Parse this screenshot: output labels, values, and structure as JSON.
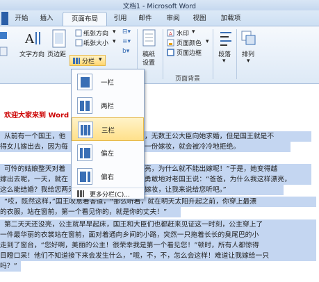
{
  "window": {
    "title": "文档1 - Microsoft Word"
  },
  "tabs": [
    "开始",
    "插入",
    "页面布局",
    "引用",
    "邮件",
    "审阅",
    "视图",
    "加载项"
  ],
  "ribbon": {
    "text_direction": "文字方向",
    "margins": "页边距",
    "orientation": "纸张方向",
    "size": "纸张大小",
    "columns": "分栏",
    "manuscript_1": "稿纸",
    "manuscript_2": "设置",
    "watermark": "水印",
    "page_color": "页面颜色",
    "page_border": "页面边框",
    "page_background": "页面背景",
    "paragraph": "段落",
    "arrange": "排列"
  },
  "columns_menu": {
    "options": [
      "一栏",
      "两栏",
      "三栏",
      "偏左",
      "偏右"
    ],
    "highlighted": "三栏",
    "more": "更多分栏(C)..."
  },
  "document": {
    "heading": "欢迎大家来到 Word",
    "lines": [
      "从前有一个国王，他",
      "得女儿嫁出去，因为每",
      "可怜的姑娘整天对着",
      "嫁出去呢，一天，就在",
      "这么能结婚？我给您两天",
      "“哎，既然这样，”国王叹息着答道，“那么听着，就在明天太阳升起之前，你穿上最漂",
      "的衣服，站在窗前，第一个看见你的，就是你的丈夫！”",
      "第二天天还没亮，公主就早早起床，国王和大臣们也都赶来见证这一时刻，公主穿上了",
      "一件最华丽的衣裳站在窗前，面对着通向乡间的小路，突然一只拖着长长的臭尾巴的小",
      "走到了窗台，“您好啊，美丽的公主！很荣幸我是第一个看见您！”顿时，所有人都惊得",
      "目瞪口呆！他们不知道接下来会发生什么，“哦，不，不，怎么会这样！难道让我嫁给一只",
      "吗？”"
    ],
    "right_lines": [
      "，无数王公大臣向她求婚，但是国王就是不",
      "一份嫁妆，就会被冷冷地拒绝。",
      "亮，为什么就不能出嫁呢！”于是，她变得越",
      "勇敢地对老国王说：“爸爸，为什么我这样漂亮，",
      "嫁妆，让我来说给您听吧。”"
    ]
  }
}
